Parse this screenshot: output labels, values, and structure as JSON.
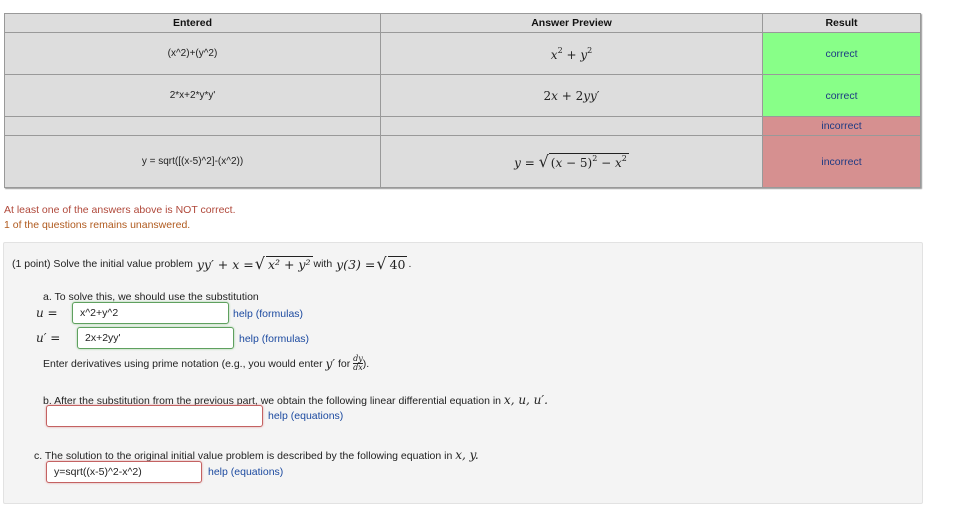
{
  "table": {
    "headers": [
      "Entered",
      "Answer Preview",
      "Result"
    ],
    "rows": [
      {
        "entered": "(x^2)+(y^2)",
        "preview": "x² + y²",
        "result": "correct",
        "status": "ok"
      },
      {
        "entered": "2*x+2*y*y'",
        "preview": "2x + 2yy′",
        "result": "correct",
        "status": "ok"
      },
      {
        "entered": "",
        "preview": "",
        "result": "incorrect",
        "status": "bad"
      },
      {
        "entered": "y = sqrt([(x-5)^2]-(x^2))",
        "preview": "y = √((x − 5)² − x²)",
        "result": "incorrect",
        "status": "bad"
      }
    ],
    "colors": {
      "correct": "#88ff88",
      "incorrect": "#d69090",
      "header": "#dddddd"
    }
  },
  "messages": {
    "not_correct": "At least one of the answers above is NOT correct.",
    "unanswered": "1 of the questions remains unanswered."
  },
  "problem": {
    "intro": "(1 point) Solve the initial value problem",
    "equation_lhs": "yy′ + x =",
    "equation_rad": "x² + y²",
    "with": "with",
    "initial_lhs": "y(3) =",
    "initial_rad": "40",
    "end": ".",
    "part_a": {
      "text": "a. To solve this, we should use the substitution",
      "u_label": "u =",
      "u_value": "x^2+y^2",
      "u_help": "help (formulas)",
      "uprime_label": "u′ =",
      "uprime_value": "2x+2yy'",
      "uprime_help": "help (formulas)",
      "note_before": "Enter derivatives using prime notation (e.g., you would enter",
      "note_yprime": "y′",
      "note_for": "for",
      "note_frac_num": "dy",
      "note_frac_den": "dx",
      "note_end": ")."
    },
    "part_b": {
      "text": "b. After the substitution from the previous part, we obtain the following linear differential equation in",
      "vars": "x, u, u′.",
      "value": "",
      "help": "help (equations)"
    },
    "part_c": {
      "text": "c. The solution to the original initial value problem is described by the following equation in",
      "vars": "x, y.",
      "value": "y=sqrt((x-5)^2-x^2)",
      "help": "help (equations)"
    }
  }
}
